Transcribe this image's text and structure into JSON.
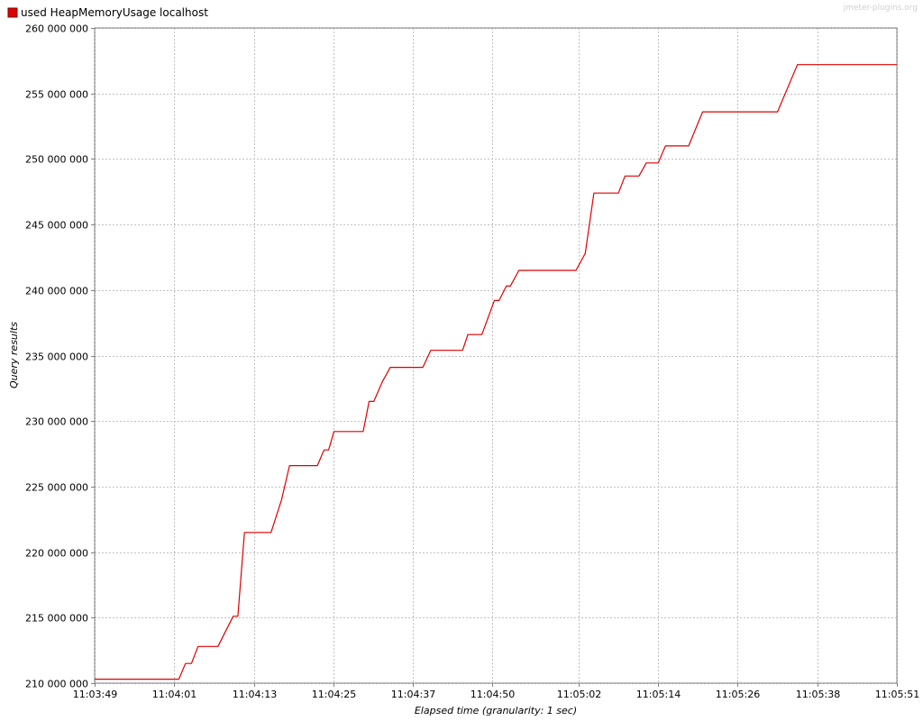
{
  "watermark": "jmeter-plugins.org",
  "colors": {
    "series": "#dd0000",
    "grid": "#c0c0c0",
    "axis": "#808080",
    "background": "#ffffff"
  },
  "chart_data": {
    "type": "line",
    "title": "",
    "xlabel": "Elapsed time (granularity: 1 sec)",
    "ylabel": "Query results",
    "legend_position": "top-left",
    "grid": true,
    "xlim": [
      0,
      122
    ],
    "ylim": [
      210000000,
      260000000
    ],
    "x_unit": "seconds since 11:03:49",
    "x_ticks": [
      0,
      12,
      24,
      36,
      48,
      60,
      73,
      85,
      97,
      109,
      121
    ],
    "x_tick_labels": [
      "11:03:49",
      "11:04:01",
      "11:04:13",
      "11:04:25",
      "11:04:37",
      "11:04:50",
      "11:05:02",
      "11:05:14",
      "11:05:26",
      "11:05:38",
      "11:05:51"
    ],
    "y_ticks": [
      210000000,
      215000000,
      220000000,
      225000000,
      230000000,
      235000000,
      240000000,
      245000000,
      250000000,
      255000000,
      260000000
    ],
    "y_tick_labels": [
      "210 000 000",
      "215 000 000",
      "220 000 000",
      "225 000 000",
      "230 000 000",
      "235 000 000",
      "240 000 000",
      "245 000 000",
      "250 000 000",
      "255 000 000",
      "260 000 000"
    ],
    "series": [
      {
        "name": "used HeapMemoryUsage localhost",
        "color": "#dd0000",
        "points": [
          [
            0,
            210300000
          ],
          [
            12.7,
            210300000
          ],
          [
            13.7,
            211500000
          ],
          [
            14.6,
            211500000
          ],
          [
            15.6,
            212800000
          ],
          [
            18.6,
            212800000
          ],
          [
            20.9,
            215100000
          ],
          [
            21.6,
            215100000
          ],
          [
            22.6,
            221500000
          ],
          [
            26.6,
            221500000
          ],
          [
            28.2,
            224000000
          ],
          [
            29.4,
            226600000
          ],
          [
            33.6,
            226600000
          ],
          [
            34.6,
            227800000
          ],
          [
            35.3,
            227800000
          ],
          [
            36.1,
            229200000
          ],
          [
            40.5,
            229200000
          ],
          [
            41.4,
            231500000
          ],
          [
            42.1,
            231500000
          ],
          [
            43.4,
            233000000
          ],
          [
            44.6,
            234100000
          ],
          [
            49.5,
            234100000
          ],
          [
            50.7,
            235400000
          ],
          [
            55.5,
            235400000
          ],
          [
            56.3,
            236600000
          ],
          [
            58.4,
            236600000
          ],
          [
            60.3,
            239200000
          ],
          [
            61.0,
            239200000
          ],
          [
            62.1,
            240300000
          ],
          [
            62.7,
            240300000
          ],
          [
            64.0,
            241500000
          ],
          [
            72.6,
            241500000
          ],
          [
            74.0,
            242800000
          ],
          [
            75.3,
            247400000
          ],
          [
            79.0,
            247400000
          ],
          [
            80.0,
            248700000
          ],
          [
            82.1,
            248700000
          ],
          [
            83.2,
            249700000
          ],
          [
            85.0,
            249700000
          ],
          [
            86.1,
            251000000
          ],
          [
            89.6,
            251000000
          ],
          [
            91.7,
            253600000
          ],
          [
            103.0,
            253600000
          ],
          [
            106.0,
            257200000
          ],
          [
            121.0,
            257200000
          ]
        ]
      }
    ]
  }
}
